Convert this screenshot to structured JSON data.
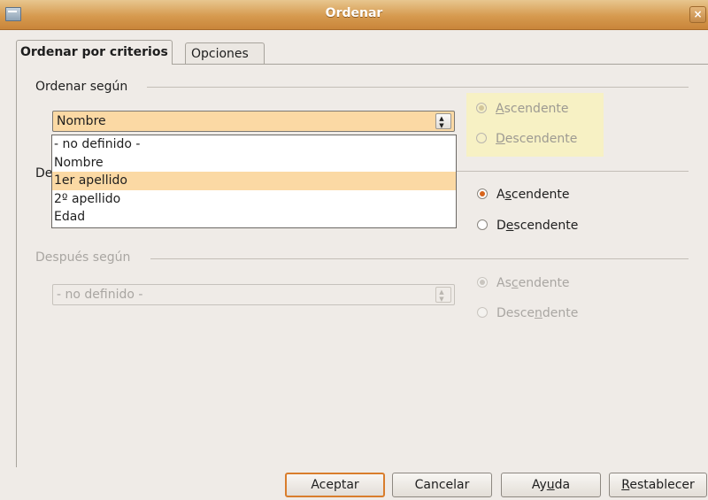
{
  "window": {
    "title": "Ordenar",
    "close": "×"
  },
  "tabs": [
    {
      "label": "Ordenar por criterios"
    },
    {
      "label": "Opciones"
    }
  ],
  "sort1": {
    "heading": "Ordenar según",
    "selected": "Nombre",
    "spin": "▲▼",
    "ascending": {
      "pre": "",
      "mn": "A",
      "post": "scendente"
    },
    "descending": {
      "pre": "",
      "mn": "D",
      "post": "escendente"
    },
    "ascending_checked": true
  },
  "dropdown": {
    "options": [
      "- no definido -",
      "Nombre",
      "1er apellido",
      "2º apellido",
      "Edad"
    ],
    "selected_index": 2
  },
  "sort2": {
    "heading": "De",
    "ascending": {
      "pre": "A",
      "mn": "s",
      "post": "cendente"
    },
    "descending": {
      "pre": "D",
      "mn": "e",
      "post": "scendente"
    },
    "ascending_checked": true
  },
  "sort3": {
    "heading": "Después según",
    "selected": "- no definido -",
    "spin": "▲▼",
    "ascending": {
      "pre": "As",
      "mn": "c",
      "post": "endente"
    },
    "descending": {
      "pre": "Desce",
      "mn": "n",
      "post": "dente"
    },
    "ascending_checked": true
  },
  "buttons": {
    "ok": "Aceptar",
    "cancel": "Cancelar",
    "help": {
      "pre": "Ay",
      "mn": "u",
      "post": "da"
    },
    "reset": {
      "pre": "",
      "mn": "R",
      "post": "establecer"
    }
  },
  "colors": {
    "accent": "#d97d2c",
    "selection": "#fbd9a4",
    "title_bar": "#d69a4f"
  }
}
